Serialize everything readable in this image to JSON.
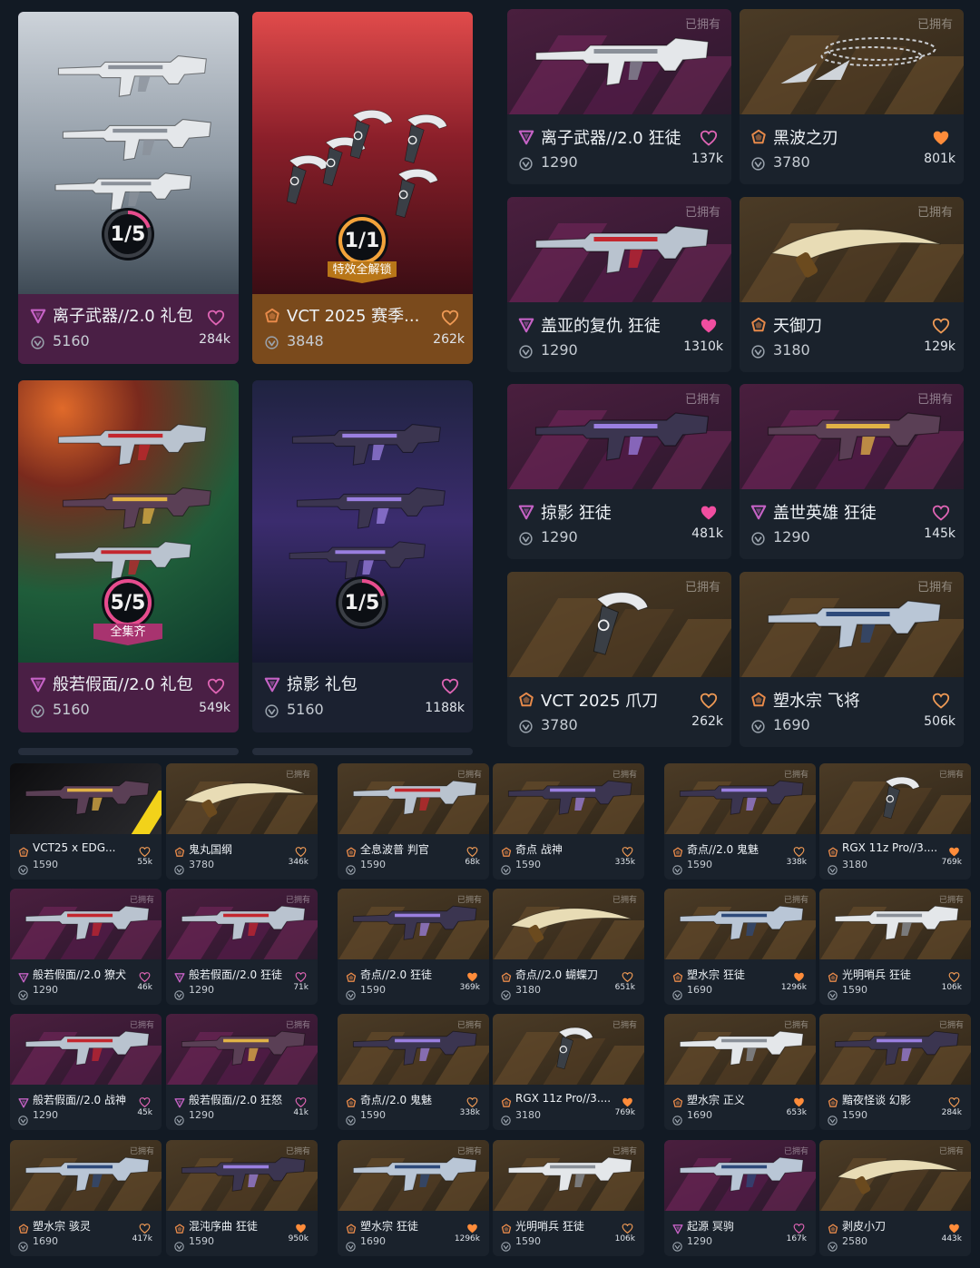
{
  "owned_label": "已拥有",
  "colors": {
    "page_bg": "#121a24",
    "premium_tier": "#c562c5",
    "exclusive_tier": "#e88a4a",
    "heart_filled_pink": "#f04ea0",
    "heart_filled_orange": "#ff8c3a"
  },
  "bundles": [
    {
      "name": "离子武器//2.0 礼包",
      "price": "5160",
      "likes": "284k",
      "progress": "1/5",
      "progress_fraction": 0.2,
      "tier": "premium",
      "heart": "outline",
      "ribbon": ""
    },
    {
      "name": "VCT 2025 赛季...",
      "price": "3848",
      "likes": "262k",
      "progress": "1/1",
      "progress_fraction": 1.0,
      "tier": "exclusive",
      "heart": "outline",
      "ribbon": "特效全解锁"
    },
    {
      "name": "般若假面//2.0 礼包",
      "price": "5160",
      "likes": "549k",
      "progress": "5/5",
      "progress_fraction": 1.0,
      "tier": "premium",
      "heart": "outline",
      "ribbon": "全集齐"
    },
    {
      "name": "掠影 礼包",
      "price": "5160",
      "likes": "1188k",
      "progress": "1/5",
      "progress_fraction": 0.2,
      "tier": "premium",
      "heart": "outline",
      "ribbon": ""
    }
  ],
  "medium_items": [
    {
      "name": "离子武器//2.0 狂徒",
      "price": "1290",
      "likes": "137k",
      "tier": "premium",
      "heart": "outline",
      "weapon": "rifle-white"
    },
    {
      "name": "黑波之刃",
      "price": "3780",
      "likes": "801k",
      "tier": "exclusive",
      "heart": "filled",
      "weapon": "chain-blades"
    },
    {
      "name": "盖亚的复仇 狂徒",
      "price": "1290",
      "likes": "1310k",
      "tier": "premium",
      "heart": "filled",
      "weapon": "rifle-vine"
    },
    {
      "name": "天御刀",
      "price": "3180",
      "likes": "129k",
      "tier": "exclusive",
      "heart": "outline",
      "weapon": "katana"
    },
    {
      "name": "掠影 狂徒",
      "price": "1290",
      "likes": "481k",
      "tier": "premium",
      "heart": "filled",
      "weapon": "rifle-dark"
    },
    {
      "name": "盖世英雄 狂徒",
      "price": "1290",
      "likes": "145k",
      "tier": "premium",
      "heart": "outline",
      "weapon": "rifle-gold"
    },
    {
      "name": "VCT 2025 爪刀",
      "price": "3780",
      "likes": "262k",
      "tier": "exclusive",
      "heart": "outline",
      "weapon": "karambit"
    },
    {
      "name": "塑水宗 飞将",
      "price": "1690",
      "likes": "506k",
      "tier": "exclusive",
      "heart": "outline",
      "weapon": "sniper"
    }
  ],
  "small_items": [
    {
      "name": "VCT25 x EDG...",
      "price": "1590",
      "likes": "55k",
      "tier": "exclusive",
      "heart": "outline",
      "owned": false,
      "bg": "special"
    },
    {
      "name": "鬼丸国纲",
      "price": "3780",
      "likes": "346k",
      "tier": "exclusive",
      "heart": "outline",
      "owned": true,
      "bg": "brown"
    },
    {
      "name": "全息波普 判官",
      "price": "1590",
      "likes": "68k",
      "tier": "exclusive",
      "heart": "outline",
      "owned": true,
      "bg": "brown"
    },
    {
      "name": "奇点 战神",
      "price": "1590",
      "likes": "335k",
      "tier": "exclusive",
      "heart": "outline",
      "owned": true,
      "bg": "brown"
    },
    {
      "name": "奇点//2.0 鬼魅",
      "price": "1590",
      "likes": "338k",
      "tier": "exclusive",
      "heart": "outline",
      "owned": true,
      "bg": "brown"
    },
    {
      "name": "RGX 11z Pro//3....",
      "price": "3180",
      "likes": "769k",
      "tier": "exclusive",
      "heart": "filled",
      "owned": true,
      "bg": "brown"
    },
    {
      "name": "般若假面//2.0 獠犬",
      "price": "1290",
      "likes": "46k",
      "tier": "premium",
      "heart": "outline",
      "owned": true,
      "bg": "purple"
    },
    {
      "name": "般若假面//2.0 狂徒",
      "price": "1290",
      "likes": "71k",
      "tier": "premium",
      "heart": "outline",
      "owned": true,
      "bg": "purple"
    },
    {
      "name": "奇点//2.0 狂徒",
      "price": "1590",
      "likes": "369k",
      "tier": "exclusive",
      "heart": "filled",
      "owned": true,
      "bg": "brown"
    },
    {
      "name": "奇点//2.0 蝴蝶刀",
      "price": "3180",
      "likes": "651k",
      "tier": "exclusive",
      "heart": "outline",
      "owned": true,
      "bg": "brown"
    },
    {
      "name": "塑水宗 狂徒",
      "price": "1690",
      "likes": "1296k",
      "tier": "exclusive",
      "heart": "filled",
      "owned": true,
      "bg": "brown"
    },
    {
      "name": "光明哨兵 狂徒",
      "price": "1590",
      "likes": "106k",
      "tier": "exclusive",
      "heart": "outline",
      "owned": true,
      "bg": "brown"
    },
    {
      "name": "般若假面//2.0 战神",
      "price": "1290",
      "likes": "45k",
      "tier": "premium",
      "heart": "outline",
      "owned": true,
      "bg": "purple"
    },
    {
      "name": "般若假面//2.0 狂怒",
      "price": "1290",
      "likes": "41k",
      "tier": "premium",
      "heart": "outline",
      "owned": true,
      "bg": "purple"
    },
    {
      "name": "奇点//2.0 鬼魅",
      "price": "1590",
      "likes": "338k",
      "tier": "exclusive",
      "heart": "outline",
      "owned": true,
      "bg": "brown"
    },
    {
      "name": "RGX 11z Pro//3....",
      "price": "3180",
      "likes": "769k",
      "tier": "exclusive",
      "heart": "filled",
      "owned": true,
      "bg": "brown"
    },
    {
      "name": "塑水宗 正义",
      "price": "1690",
      "likes": "653k",
      "tier": "exclusive",
      "heart": "filled",
      "owned": true,
      "bg": "brown"
    },
    {
      "name": "黯夜怪谈 幻影",
      "price": "1590",
      "likes": "284k",
      "tier": "exclusive",
      "heart": "outline",
      "owned": true,
      "bg": "brown"
    },
    {
      "name": "塑水宗 骇灵",
      "price": "1690",
      "likes": "417k",
      "tier": "exclusive",
      "heart": "outline",
      "owned": true,
      "bg": "brown"
    },
    {
      "name": "混沌序曲 狂徒",
      "price": "1590",
      "likes": "950k",
      "tier": "exclusive",
      "heart": "filled",
      "owned": true,
      "bg": "brown"
    },
    {
      "name": "塑水宗 狂徒",
      "price": "1690",
      "likes": "1296k",
      "tier": "exclusive",
      "heart": "filled",
      "owned": true,
      "bg": "brown"
    },
    {
      "name": "光明哨兵 狂徒",
      "price": "1590",
      "likes": "106k",
      "tier": "exclusive",
      "heart": "outline",
      "owned": true,
      "bg": "brown"
    },
    {
      "name": "起源 冥驹",
      "price": "1290",
      "likes": "167k",
      "tier": "premium",
      "heart": "outline",
      "owned": true,
      "bg": "purple"
    },
    {
      "name": "剥皮小刀",
      "price": "2580",
      "likes": "443k",
      "tier": "exclusive",
      "heart": "filled",
      "owned": true,
      "bg": "brown"
    }
  ]
}
